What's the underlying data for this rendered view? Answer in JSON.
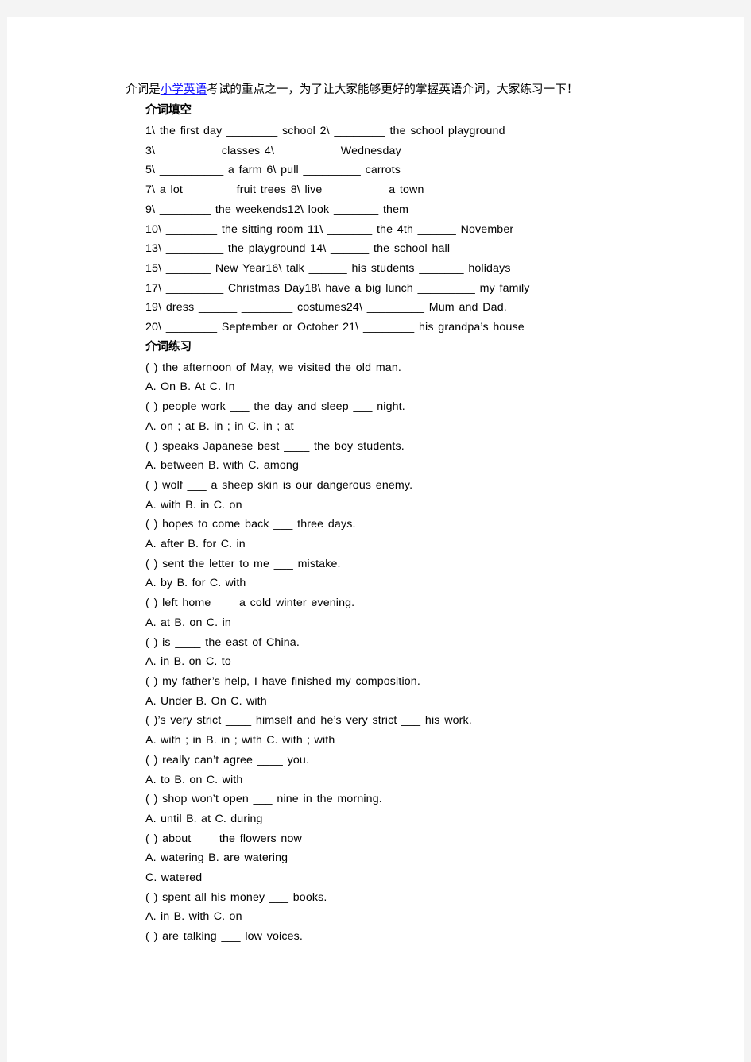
{
  "document": {
    "intro": {
      "before_link": "介词是",
      "link_text": "小学英语",
      "after_link": "考试的重点之一，为了让大家能够更好的掌握英语介词，大家练习一下！"
    },
    "link_color": "#1414ff",
    "section_fill": {
      "heading": "介词填空",
      "lines": [
        "1\\ the first day ________ school 2\\ ________ the school playground",
        "3\\ _________ classes 4\\ _________ Wednesday",
        "5\\ __________ a farm 6\\ pull _________ carrots",
        "7\\ a lot _______ fruit trees 8\\ live _________ a town",
        "9\\ ________ the weekends12\\ look _______ them",
        "10\\ ________ the sitting room 11\\ _______ the 4th ______ November",
        "13\\ _________ the playground 14\\ ______ the school hall",
        "15\\ _______ New Year16\\ talk ______ his students _______ holidays",
        "17\\ _________ Christmas Day18\\ have a big lunch _________ my family",
        "19\\ dress ______ ________ costumes24\\ _________ Mum and Dad.",
        "20\\ ________ September or October 21\\ ________ his grandpa’s house"
      ]
    },
    "section_practice": {
      "heading": "介词练习",
      "items": [
        {
          "question": "( ) the afternoon of May, we visited the old man.",
          "options": [
            "A. On B. At C. In"
          ]
        },
        {
          "question": "( ) people work ___ the day and sleep ___ night.",
          "options": [
            "A. on ; at B. in ; in C. in ; at"
          ]
        },
        {
          "question": "( ) speaks Japanese best ____ the boy students.",
          "options": [
            "A. between B. with C. among"
          ]
        },
        {
          "question": "( ) wolf ___ a sheep skin is our dangerous enemy.",
          "options": [
            "A. with B. in C. on"
          ]
        },
        {
          "question": "( ) hopes to come back ___ three days.",
          "options": [
            "A. after B. for C. in"
          ]
        },
        {
          "question": "( ) sent the letter to me ___ mistake.",
          "options": [
            "A. by B. for C. with"
          ]
        },
        {
          "question": "( ) left home ___ a cold winter evening.",
          "options": [
            "A. at B. on C. in"
          ]
        },
        {
          "question": "( ) is ____ the east of China.",
          "options": [
            "A. in B. on C. to"
          ]
        },
        {
          "question": "( ) my father’s help, I have finished my composition.",
          "options": [
            "A. Under B. On C. with"
          ]
        },
        {
          "question": "( )’s very strict ____ himself and he’s very strict ___ his work.",
          "options": [
            "A. with ; in B. in ; with C. with ; with"
          ]
        },
        {
          "question": "( ) really can’t agree ____ you.",
          "options": [
            "A. to B. on C. with"
          ]
        },
        {
          "question": "( ) shop won’t open ___ nine in the morning.",
          "options": [
            "A. until B. at C. during"
          ]
        },
        {
          "question": "( ) about ___ the flowers now",
          "options": [
            "A. watering B. are watering",
            "C. watered"
          ]
        },
        {
          "question": "( ) spent all his money ___ books.",
          "options": [
            "A. in B. with C. on"
          ]
        },
        {
          "question": "( ) are talking ___ low voices.",
          "options": []
        }
      ]
    }
  }
}
